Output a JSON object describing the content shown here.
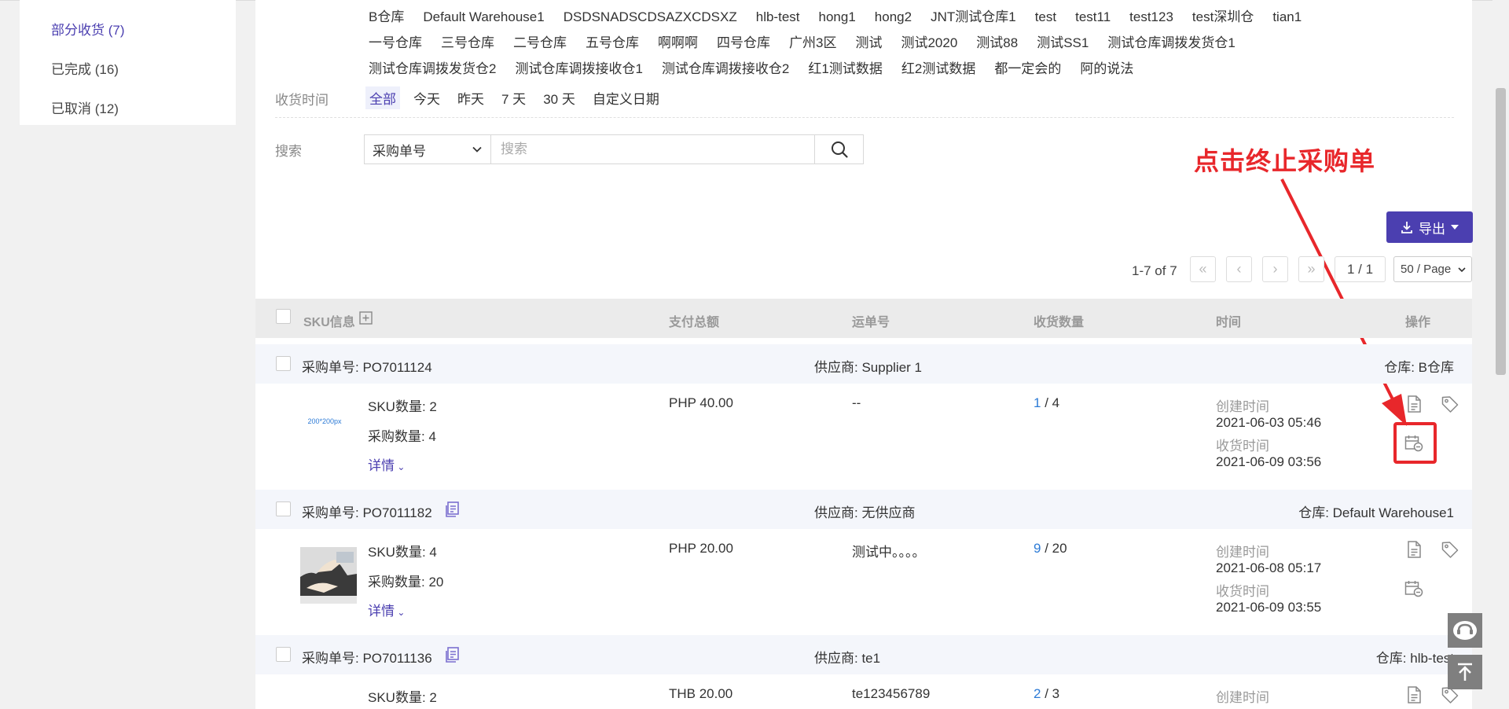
{
  "sidebar": {
    "items": [
      {
        "label": "部分收货 (7)"
      },
      {
        "label": "已完成 (16)"
      },
      {
        "label": "已取消 (12)"
      }
    ]
  },
  "filters": {
    "warehouse_rows": [
      [
        "B仓库",
        "Default Warehouse1",
        "DSDSNADSCDSAZXCDSXZ",
        "hlb-test",
        "hong1",
        "hong2",
        "JNT测试仓库1",
        "test",
        "test11",
        "test123",
        "test深圳仓",
        "tian1"
      ],
      [
        "一号仓库",
        "三号仓库",
        "二号仓库",
        "五号仓库",
        "啊啊啊",
        "四号仓库",
        "广州3区",
        "测试",
        "测试2020",
        "测试88",
        "测试SS1",
        "测试仓库调拨发货仓1"
      ],
      [
        "测试仓库调拨发货仓2",
        "测试仓库调拨接收仓1",
        "测试仓库调拨接收仓2",
        "红1测试数据",
        "红2测试数据",
        "都一定会的",
        "阿的说法"
      ]
    ],
    "time_label": "收货时间",
    "time_options": [
      "全部",
      "今天",
      "昨天",
      "7 天",
      "30 天",
      "自定义日期"
    ],
    "search_label": "搜索",
    "search_type": "采购单号",
    "search_placeholder": "搜索"
  },
  "annotation": {
    "text": "点击终止采购单",
    "color": "#e8272b"
  },
  "toolbar": {
    "export_label": "导出"
  },
  "pagination": {
    "info": "1-7 of 7",
    "page": "1 / 1",
    "page_size": "50 / Page"
  },
  "table": {
    "headers": {
      "sku": "SKU信息",
      "total": "支付总额",
      "waybill": "运单号",
      "received": "收货数量",
      "time": "时间",
      "action": "操作"
    }
  },
  "orders": [
    {
      "po_label": "采购单号: PO7011124",
      "supplier": "供应商: Supplier 1",
      "warehouse": "仓库: B仓库",
      "thumb_text": "200*200px",
      "sku_count": "SKU数量: 2",
      "purchase_qty": "采购数量: 4",
      "details": "详情",
      "total": "PHP 40.00",
      "waybill": "--",
      "received": "1",
      "ordered": "/ 4",
      "created_label": "创建时间",
      "created": "2021-06-03 05:46",
      "received_label": "收货时间",
      "received_time": "2021-06-09 03:56"
    },
    {
      "po_label": "采购单号: PO7011182",
      "supplier": "供应商: 无供应商",
      "warehouse": "仓库: Default Warehouse1",
      "sku_count": "SKU数量: 4",
      "purchase_qty": "采购数量: 20",
      "details": "详情",
      "total": "PHP 20.00",
      "waybill": "测试中。。。。",
      "received": "9",
      "ordered": "/ 20",
      "created_label": "创建时间",
      "created": "2021-06-08 05:17",
      "received_label": "收货时间",
      "received_time": "2021-06-09 03:55"
    },
    {
      "po_label": "采购单号: PO7011136",
      "supplier": "供应商: te1",
      "warehouse": "仓库: hlb-test",
      "sku_count": "SKU数量: 2",
      "total": "THB 20.00",
      "waybill": "te123456789",
      "received": "2",
      "ordered": "/ 3",
      "created_label": "创建时间"
    }
  ],
  "colors": {
    "accent": "#4b3fb0",
    "link_blue": "#2d7bd6",
    "annotation_red": "#e8272b"
  }
}
